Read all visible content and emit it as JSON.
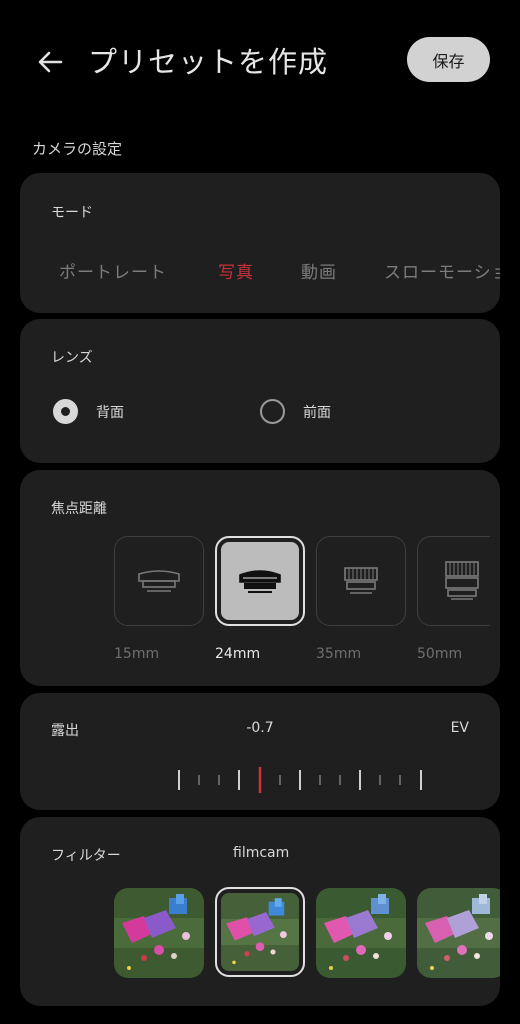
{
  "header": {
    "title": "プリセットを作成",
    "save_label": "保存"
  },
  "section_title": "カメラの設定",
  "mode": {
    "label": "モード",
    "options": [
      "ポートレート",
      "写真",
      "動画",
      "スローモーション"
    ],
    "selected": "写真"
  },
  "lens": {
    "label": "レンズ",
    "options": [
      "背面",
      "前面"
    ],
    "selected": "背面"
  },
  "focal": {
    "label": "焦点距離",
    "options": [
      "15mm",
      "24mm",
      "35mm",
      "50mm"
    ],
    "selected": "24mm"
  },
  "exposure": {
    "label": "露出",
    "value": "-0.7",
    "unit": "EV"
  },
  "filter": {
    "label": "フィルター",
    "name": "filmcam",
    "selected_index": 1
  },
  "colors": {
    "accent": "#c8323a",
    "card": "#1f1f1f",
    "background": "#000000"
  }
}
